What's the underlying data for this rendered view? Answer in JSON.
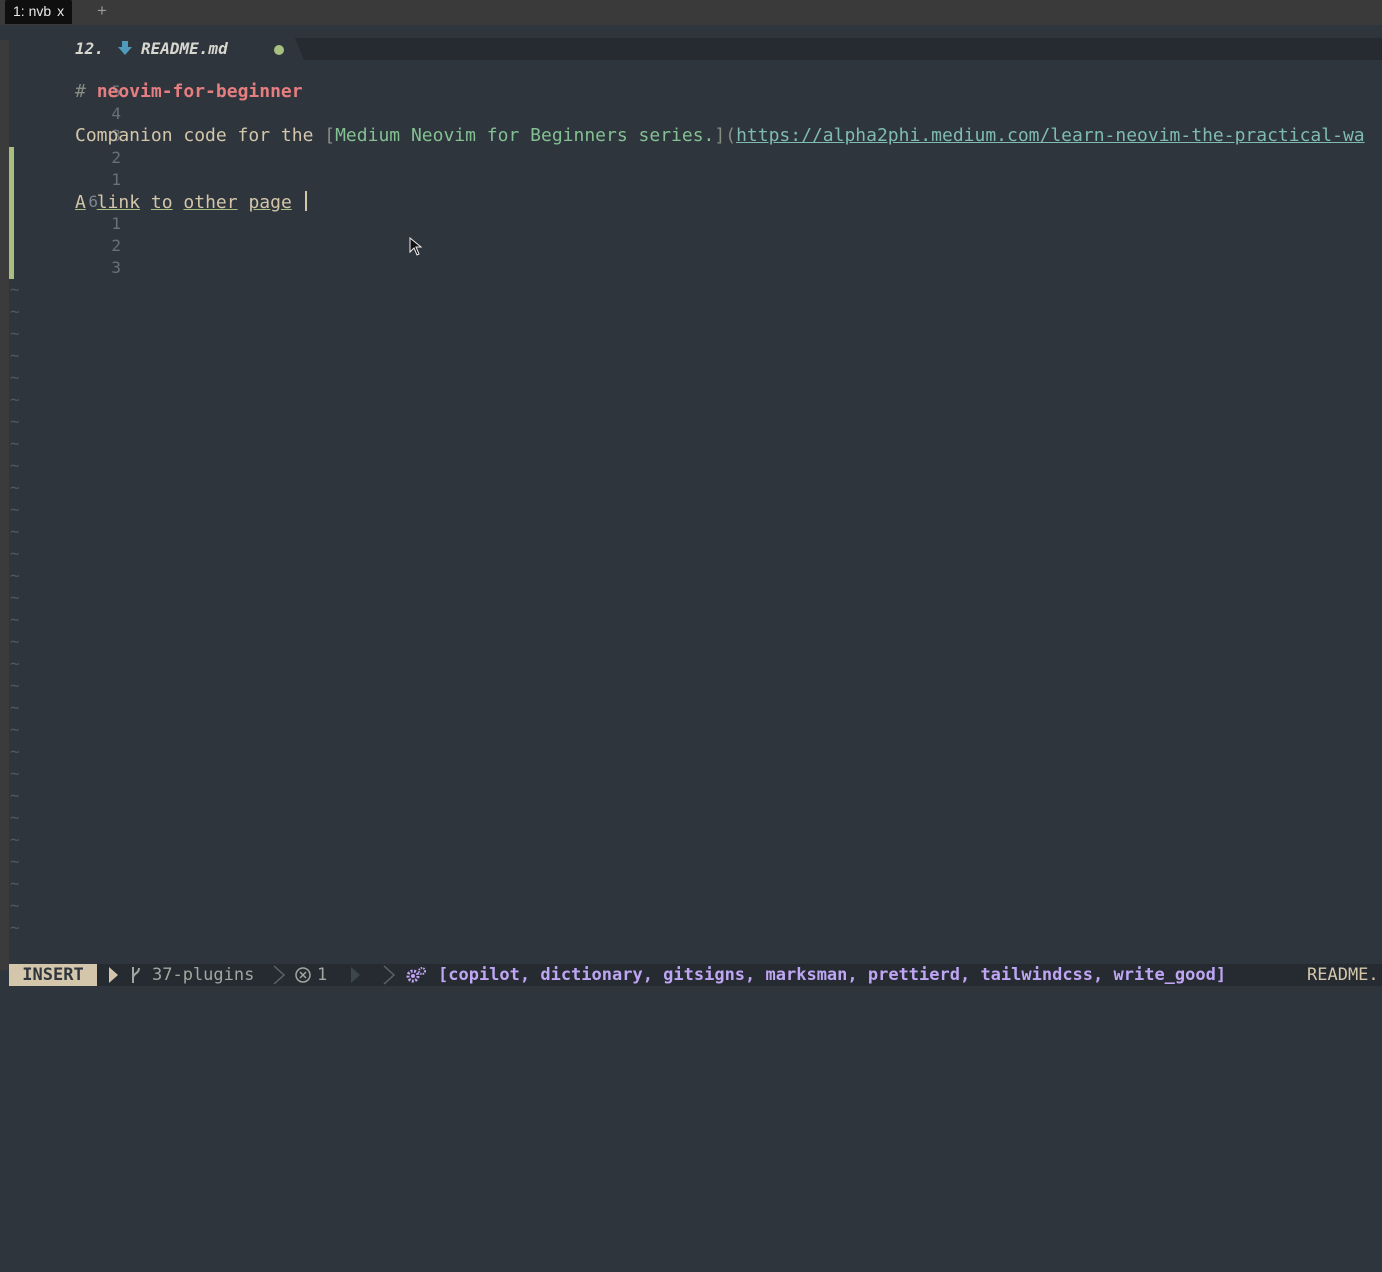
{
  "terminal": {
    "tab_label": "1: nvb",
    "tab_close": "x",
    "new_tab": "+"
  },
  "bufferline": {
    "number": "12.",
    "filename": "README.md",
    "modified_indicator": "●",
    "icon": "markdown-down-arrow-icon"
  },
  "editor": {
    "lines": [
      {
        "lnum": "5",
        "kind": "heading",
        "hash": "#",
        "text": "neovim-for-beginner"
      },
      {
        "lnum": "4",
        "kind": "blank"
      },
      {
        "lnum": "3",
        "kind": "link",
        "prefix": "Companion code for the ",
        "open": "[",
        "link_text": "Medium Neovim for Beginners series.",
        "mid": "](",
        "url": "https://alpha2phi.medium.com/learn-neovim-the-practical-wa"
      },
      {
        "lnum": "2",
        "kind": "blank"
      },
      {
        "lnum": "1",
        "kind": "blank"
      },
      {
        "lnum": "6",
        "kind": "current",
        "words": [
          "A",
          "link",
          "to",
          "other",
          "page"
        ]
      },
      {
        "lnum": "1",
        "kind": "blank"
      },
      {
        "lnum": "2",
        "kind": "blank"
      },
      {
        "lnum": "3",
        "kind": "blank"
      }
    ],
    "filler": "~"
  },
  "statusline": {
    "mode": "INSERT",
    "branch_icon": "git-branch-icon",
    "branch": "37-plugins",
    "diagnostics_icon": "error-circle-icon",
    "diagnostics_count": "1",
    "lsp_icon": "gears-icon",
    "lsp_clients": "[copilot, dictionary, gitsigns, marksman, prettierd, tailwindcss, write_good]",
    "filename": "README."
  },
  "colors": {
    "background": "#2e353d",
    "heading": "#e67e80",
    "link_text": "#83c092",
    "url": "#7fbbb3",
    "git_added": "#a7c080",
    "lsp": "#bfa6f4"
  }
}
